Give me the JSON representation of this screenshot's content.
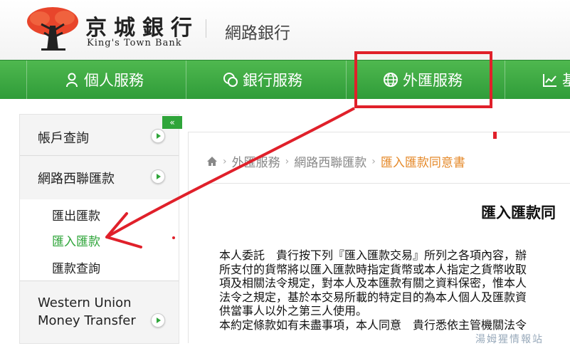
{
  "header": {
    "brand_cn": "京城銀行",
    "brand_en": "King's Town Bank",
    "section": "網路銀行"
  },
  "nav": {
    "items": [
      {
        "label": "個人服務",
        "icon": "person-icon"
      },
      {
        "label": "銀行服務",
        "icon": "coins-icon"
      },
      {
        "label": "外匯服務",
        "icon": "globe-icon"
      },
      {
        "label": "基",
        "icon": "chart-icon"
      }
    ]
  },
  "sidebar": {
    "collapse": "«",
    "items": [
      {
        "label": "帳戶查詢"
      },
      {
        "label": "網路西聯匯款"
      }
    ],
    "sub_items": [
      {
        "label": "匯出匯款"
      },
      {
        "label": "匯入匯款",
        "active": true
      },
      {
        "label": "匯款查詢"
      }
    ],
    "western_union": [
      "Western Union",
      "Money Transfer"
    ]
  },
  "breadcrumb": {
    "items": [
      "外匯服務",
      "網路西聯匯款",
      "匯入匯款同意書"
    ]
  },
  "document": {
    "title": "匯入匯款同",
    "lines": [
      "本人委託　貴行按下列『匯入匯款交易』所列之各項內容，辦",
      "所支付的貨幣將以匯入匯款時指定貨幣或本人指定之貨幣收取",
      "項及相關法令規定，對本人及本匯款有關之資料保密，惟本人",
      "法令之規定，基於本交易所載的特定目的為本人個人及匯款資",
      "供當事人以外之第三人使用。",
      "本約定條款如有未盡事項，本人同意　貴行悉依主管機關法令"
    ]
  },
  "watermark": "湯姆猩情報站",
  "colors": {
    "nav_green": "#2f9c39",
    "accent_green": "#2fa53a",
    "breadcrumb_current": "#e58a2b",
    "annotation_red": "#e0202a"
  }
}
